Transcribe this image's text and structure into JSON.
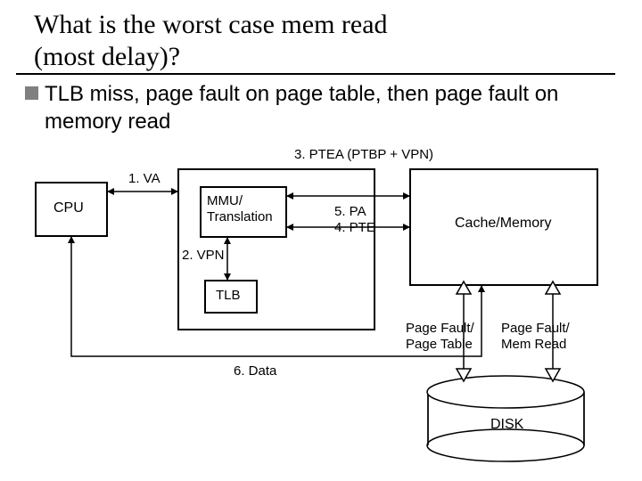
{
  "slide": {
    "title_line1": "What is the worst case mem read",
    "title_line2": "(most delay)?",
    "bullet": "TLB miss, page fault on page table, then page fault on memory read"
  },
  "labels": {
    "cpu": "CPU",
    "mmu_l1": "MMU/",
    "mmu_l2": "Translation",
    "tlb": "TLB",
    "cache": "Cache/Memory",
    "disk": "DISK",
    "step1": "1. VA",
    "step2": "2. VPN",
    "step3": "3. PTEA (PTBP + VPN)",
    "step4": "4. PTE",
    "step5": "5. PA",
    "step6": "6. Data",
    "pf1_l1": "Page Fault/",
    "pf1_l2": "Page Table",
    "pf2_l1": "Page Fault/",
    "pf2_l2": "Mem Read"
  }
}
